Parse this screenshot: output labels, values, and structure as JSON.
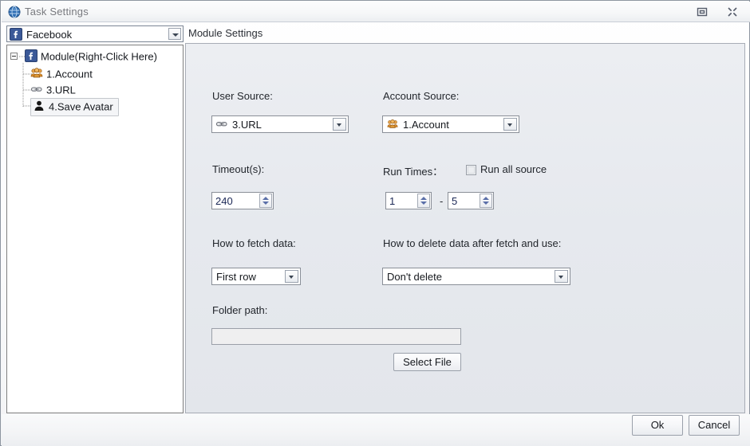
{
  "window": {
    "title": "Task Settings",
    "icon": "globe-icon",
    "buttons": {
      "restore": "restore-window",
      "close": "close-window"
    }
  },
  "sidebar": {
    "combo": {
      "value": "Facebook",
      "icon": "facebook-icon"
    },
    "tree": [
      {
        "label": "Module(Right-Click Here)",
        "icon": "facebook-icon",
        "selected": false,
        "expanded": true
      },
      {
        "label": "1.Account",
        "icon": "users-group-icon",
        "selected": false
      },
      {
        "label": "3.URL",
        "icon": "link-chain-icon",
        "selected": false
      },
      {
        "label": "4.Save Avatar",
        "icon": "person-icon",
        "selected": true
      }
    ]
  },
  "main": {
    "header": "Module Settings",
    "fields": {
      "user_source_label": "User Source:",
      "user_source_value": "3.URL",
      "user_source_icon": "link-chain-icon",
      "account_source_label": "Account Source:",
      "account_source_value": "1.Account",
      "account_source_icon": "users-group-icon",
      "timeout_label": "Timeout(s):",
      "timeout_value": "240",
      "run_times_label": "Run Times：",
      "run_all_source_label": "Run all source",
      "run_all_source_checked": false,
      "run_times_min": "1",
      "run_times_max": "5",
      "run_times_separator": "-",
      "fetch_data_label": "How to fetch data:",
      "fetch_data_value": "First row",
      "delete_data_label": "How to delete data after fetch and use:",
      "delete_data_value": "Don't delete",
      "folder_path_label": "Folder path:",
      "folder_path_value": "",
      "folder_path_placeholder": "",
      "select_file_label": "Select File"
    }
  },
  "footer": {
    "ok_label": "Ok",
    "cancel_label": "Cancel"
  },
  "colors": {
    "panel_bg": "#e6e9ee",
    "titlebar_text": "#77797e",
    "facebook_blue": "#3b5998",
    "accent_orange": "#d98c2b"
  }
}
